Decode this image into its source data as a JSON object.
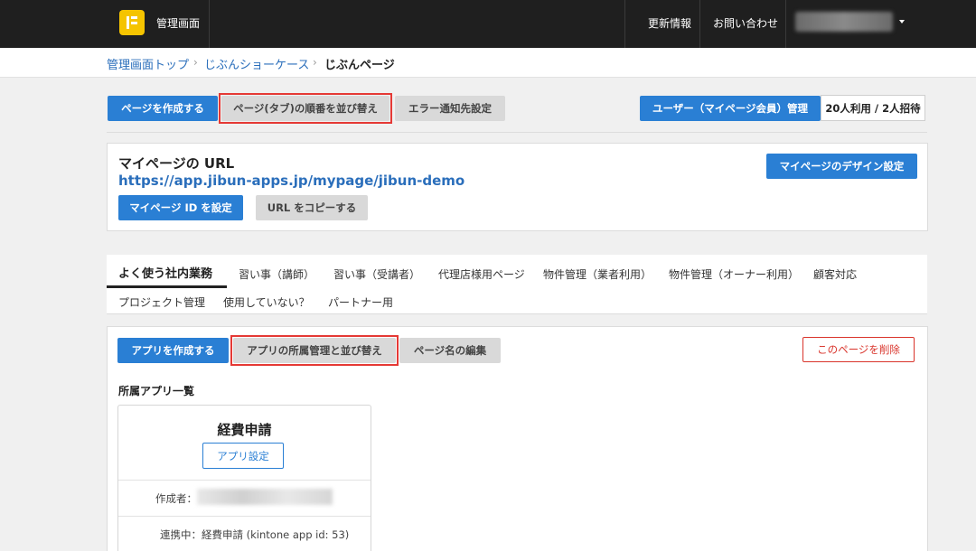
{
  "header": {
    "app_title": "管理画面",
    "links": {
      "updates": "更新情報",
      "contact": "お問い合わせ"
    }
  },
  "breadcrumb": {
    "items": [
      "管理画面トップ",
      "じぶんショーケース",
      "じぶんページ"
    ]
  },
  "toolbar": {
    "create_page": "ページを作成する",
    "reorder_pages": "ページ(タブ)の順番を並び替え",
    "error_notify": "エラー通知先設定",
    "user_manage": "ユーザー（マイページ会員）管理",
    "user_count": "20人利用 / 2人招待"
  },
  "mypage": {
    "heading": "マイページの URL",
    "url": "https://app.jibun-apps.jp/mypage/jibun-demo",
    "set_id": "マイページ ID を設定",
    "copy_url": "URL をコピーする",
    "design_settings": "マイページのデザイン設定"
  },
  "tabs": [
    "よく使う社内業務",
    "習い事（講師）",
    "習い事（受講者）",
    "代理店様用ページ",
    "物件管理（業者利用）",
    "物件管理（オーナー利用）",
    "顧客対応",
    "プロジェクト管理",
    "使用していない？",
    "パートナー用"
  ],
  "page_actions": {
    "create_app": "アプリを作成する",
    "manage_apps": "アプリの所属管理と並び替え",
    "edit_name": "ページ名の編集",
    "delete_page": "このページを削除"
  },
  "apps": {
    "section_label": "所属アプリ一覧",
    "items": [
      {
        "name": "経費申請",
        "settings_label": "アプリ設定",
        "creator_label": "作成者：",
        "link_label": "連携中：経費申請 (kintone app id: 53)"
      }
    ]
  },
  "colors": {
    "primary": "#2a7fd4",
    "header_bg": "#1f1f1f",
    "highlight": "#e53935",
    "danger": "#d9342b",
    "logo": "#f5c400"
  }
}
